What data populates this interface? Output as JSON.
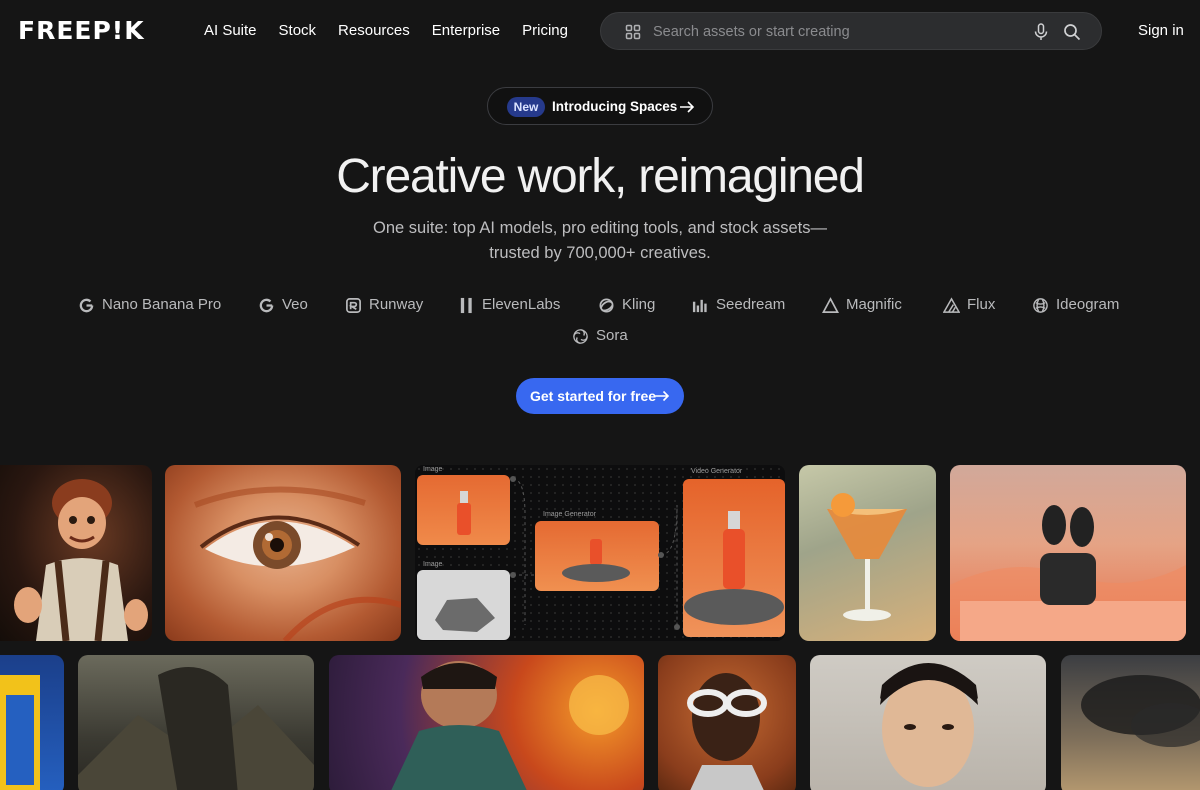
{
  "nav": {
    "logo": "FREEP!K",
    "links": [
      "AI Suite",
      "Stock",
      "Resources",
      "Enterprise",
      "Pricing"
    ],
    "search_placeholder": "Search assets or start creating",
    "sign_in": "Sign in"
  },
  "announcement": {
    "badge": "New",
    "text": "Introducing Spaces"
  },
  "hero": {
    "title": "Creative work, reimagined",
    "subtitle_line1": "One suite: top AI models, pro editing tools, and stock assets—",
    "subtitle_line2": "trusted by 700,000+ creatives."
  },
  "models": [
    {
      "name": "Nano Banana Pro",
      "icon": "google-icon"
    },
    {
      "name": "Veo",
      "icon": "google-icon"
    },
    {
      "name": "Runway",
      "icon": "runway-icon"
    },
    {
      "name": "ElevenLabs",
      "icon": "elevenlabs-icon"
    },
    {
      "name": "Kling",
      "icon": "kling-icon"
    },
    {
      "name": "Seedream",
      "icon": "seedream-icon"
    },
    {
      "name": "Magnific",
      "icon": "magnific-icon"
    },
    {
      "name": "Flux",
      "icon": "flux-icon"
    },
    {
      "name": "Ideogram",
      "icon": "ideogram-icon"
    },
    {
      "name": "Sora",
      "icon": "sora-icon"
    }
  ],
  "cta": {
    "label": "Get started for free"
  },
  "workflow": {
    "node_image_1": "Image",
    "node_image_2": "Image",
    "node_generator": "Image Generator",
    "node_video": "Video Generator"
  },
  "colors": {
    "background": "#151515",
    "accent": "#3868f0",
    "badge": "#263a8c"
  }
}
